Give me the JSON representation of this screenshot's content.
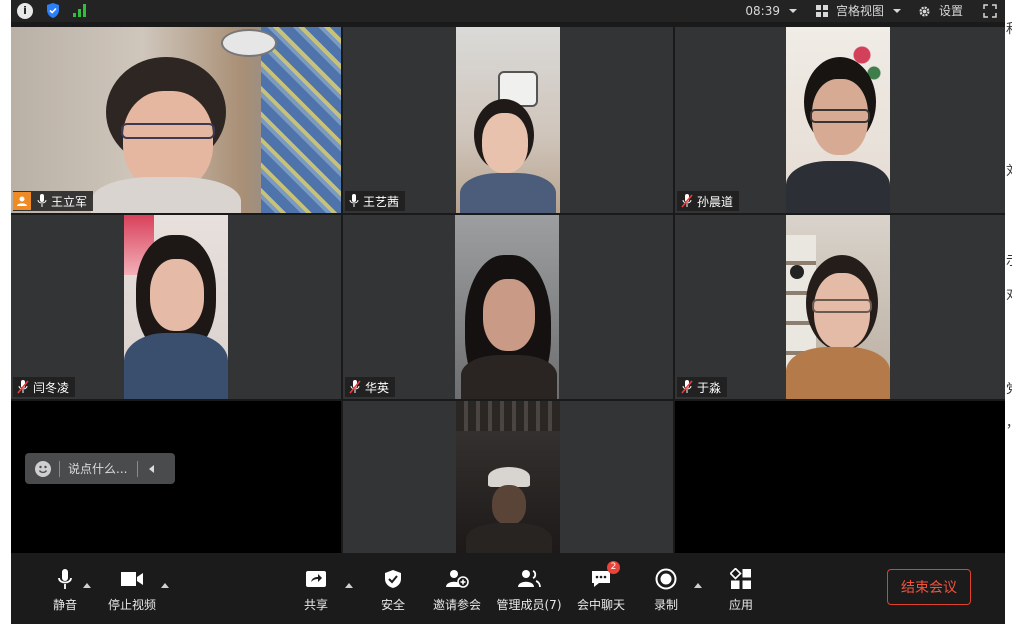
{
  "topbar": {
    "time": "08:39",
    "view_label": "宫格视图",
    "settings_label": "设置"
  },
  "participants": [
    {
      "name": "王立军",
      "host": true,
      "muted": false,
      "active": true
    },
    {
      "name": "王艺茜",
      "host": false,
      "muted": false,
      "active": false
    },
    {
      "name": "孙晨道",
      "host": false,
      "muted": true,
      "active": false
    },
    {
      "name": "闫冬凌",
      "host": false,
      "muted": true,
      "active": false
    },
    {
      "name": "华英",
      "host": false,
      "muted": true,
      "active": false
    },
    {
      "name": "于淼",
      "host": false,
      "muted": true,
      "active": false
    }
  ],
  "chat": {
    "placeholder": "说点什么..."
  },
  "toolbar": {
    "mute": "静音",
    "stop_video": "停止视频",
    "share": "共享",
    "security": "安全",
    "invite": "邀请参会",
    "manage": "管理成员(7)",
    "chat": "会中聊天",
    "chat_badge": "2",
    "record": "录制",
    "apps": "应用",
    "end": "结束会议"
  },
  "side_fragments": [
    "和",
    "刘",
    "示",
    "对",
    "党",
    "，"
  ],
  "colors": {
    "active_speaker": "#23c45e",
    "end_button": "#e0412c",
    "host_badge": "#f08a24",
    "signal": "#2fbf3a"
  }
}
